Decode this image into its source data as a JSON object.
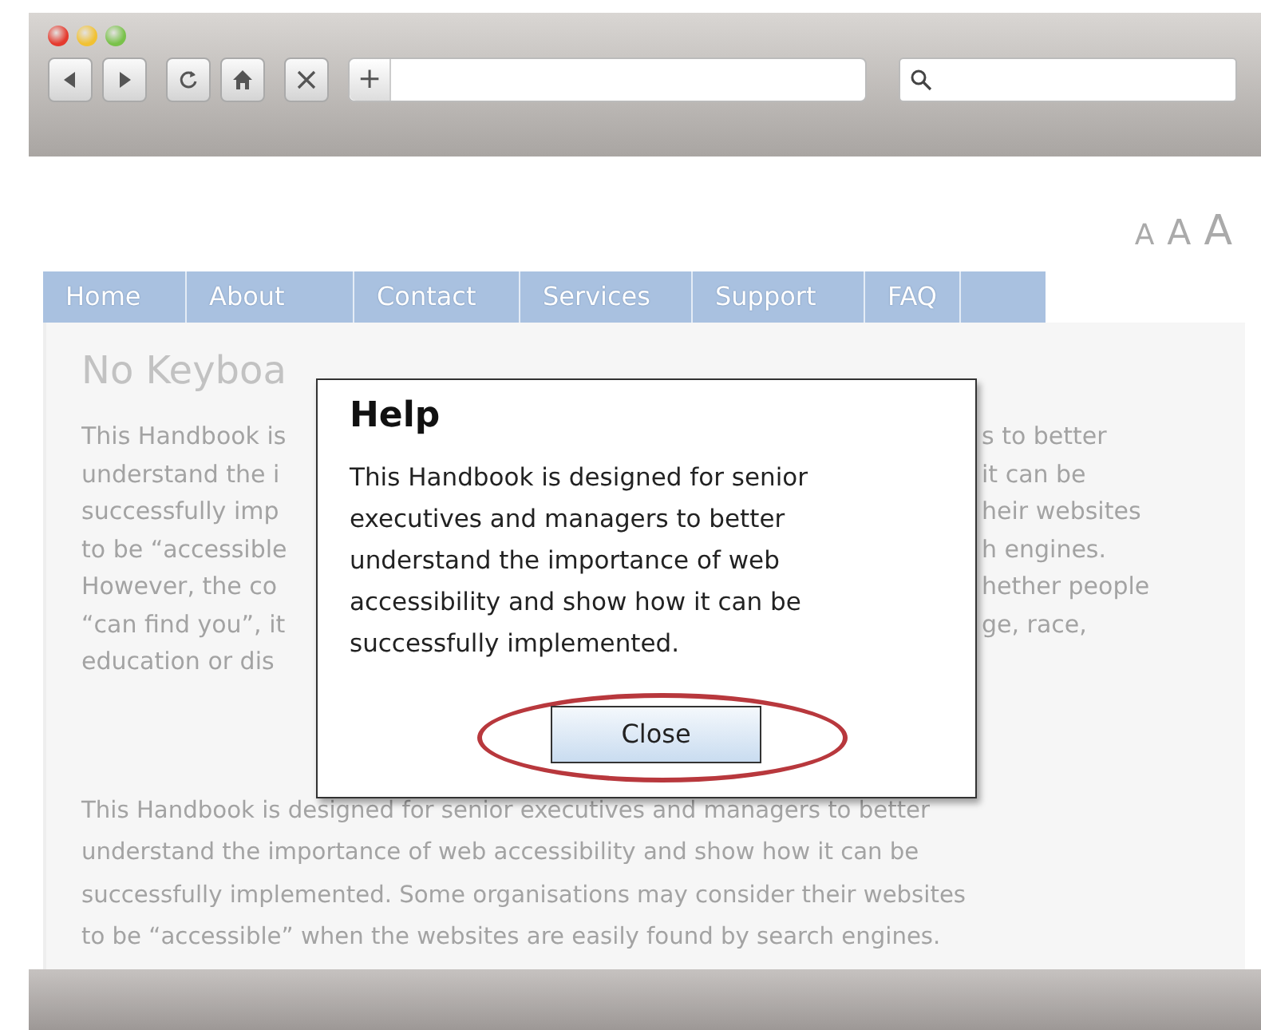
{
  "browser": {
    "address_bar": {
      "new_tab_button": "+"
    }
  },
  "page": {
    "font_size_controls": [
      "A",
      "A",
      "A"
    ],
    "nav": [
      {
        "label": "Home"
      },
      {
        "label": "About"
      },
      {
        "label": "Contact"
      },
      {
        "label": "Services"
      },
      {
        "label": "Support"
      },
      {
        "label": "FAQ"
      }
    ],
    "heading": "No Keyboa",
    "paragraph_1_lines": [
      {
        "left": "This Handbook is",
        "right": "s to better"
      },
      {
        "left": "understand the i",
        "right": "it can be"
      },
      {
        "left": "successfully imp",
        "right": "heir websites"
      },
      {
        "left": "to be “accessible",
        "right": "h engines."
      },
      {
        "left": "However, the co",
        "right": "hether people"
      },
      {
        "left": "“can find you”, it",
        "right": "ge, race,"
      },
      {
        "left": "education or dis"
      }
    ],
    "paragraph_2_lines": [
      "This Handbook is designed for senior executives and managers to better",
      "understand the importance of web accessibility and show how it can be",
      "successfully implemented. Some organisations may consider their websites",
      "to be “accessible” when the websites are easily found by search engines."
    ]
  },
  "dialog": {
    "title": "Help",
    "text": "This Handbook is designed for senior executives and managers to better understand the importance of web accessibility and show how it can be successfully implemented.",
    "close_button": {
      "label": "Close",
      "highlighted": true
    }
  }
}
